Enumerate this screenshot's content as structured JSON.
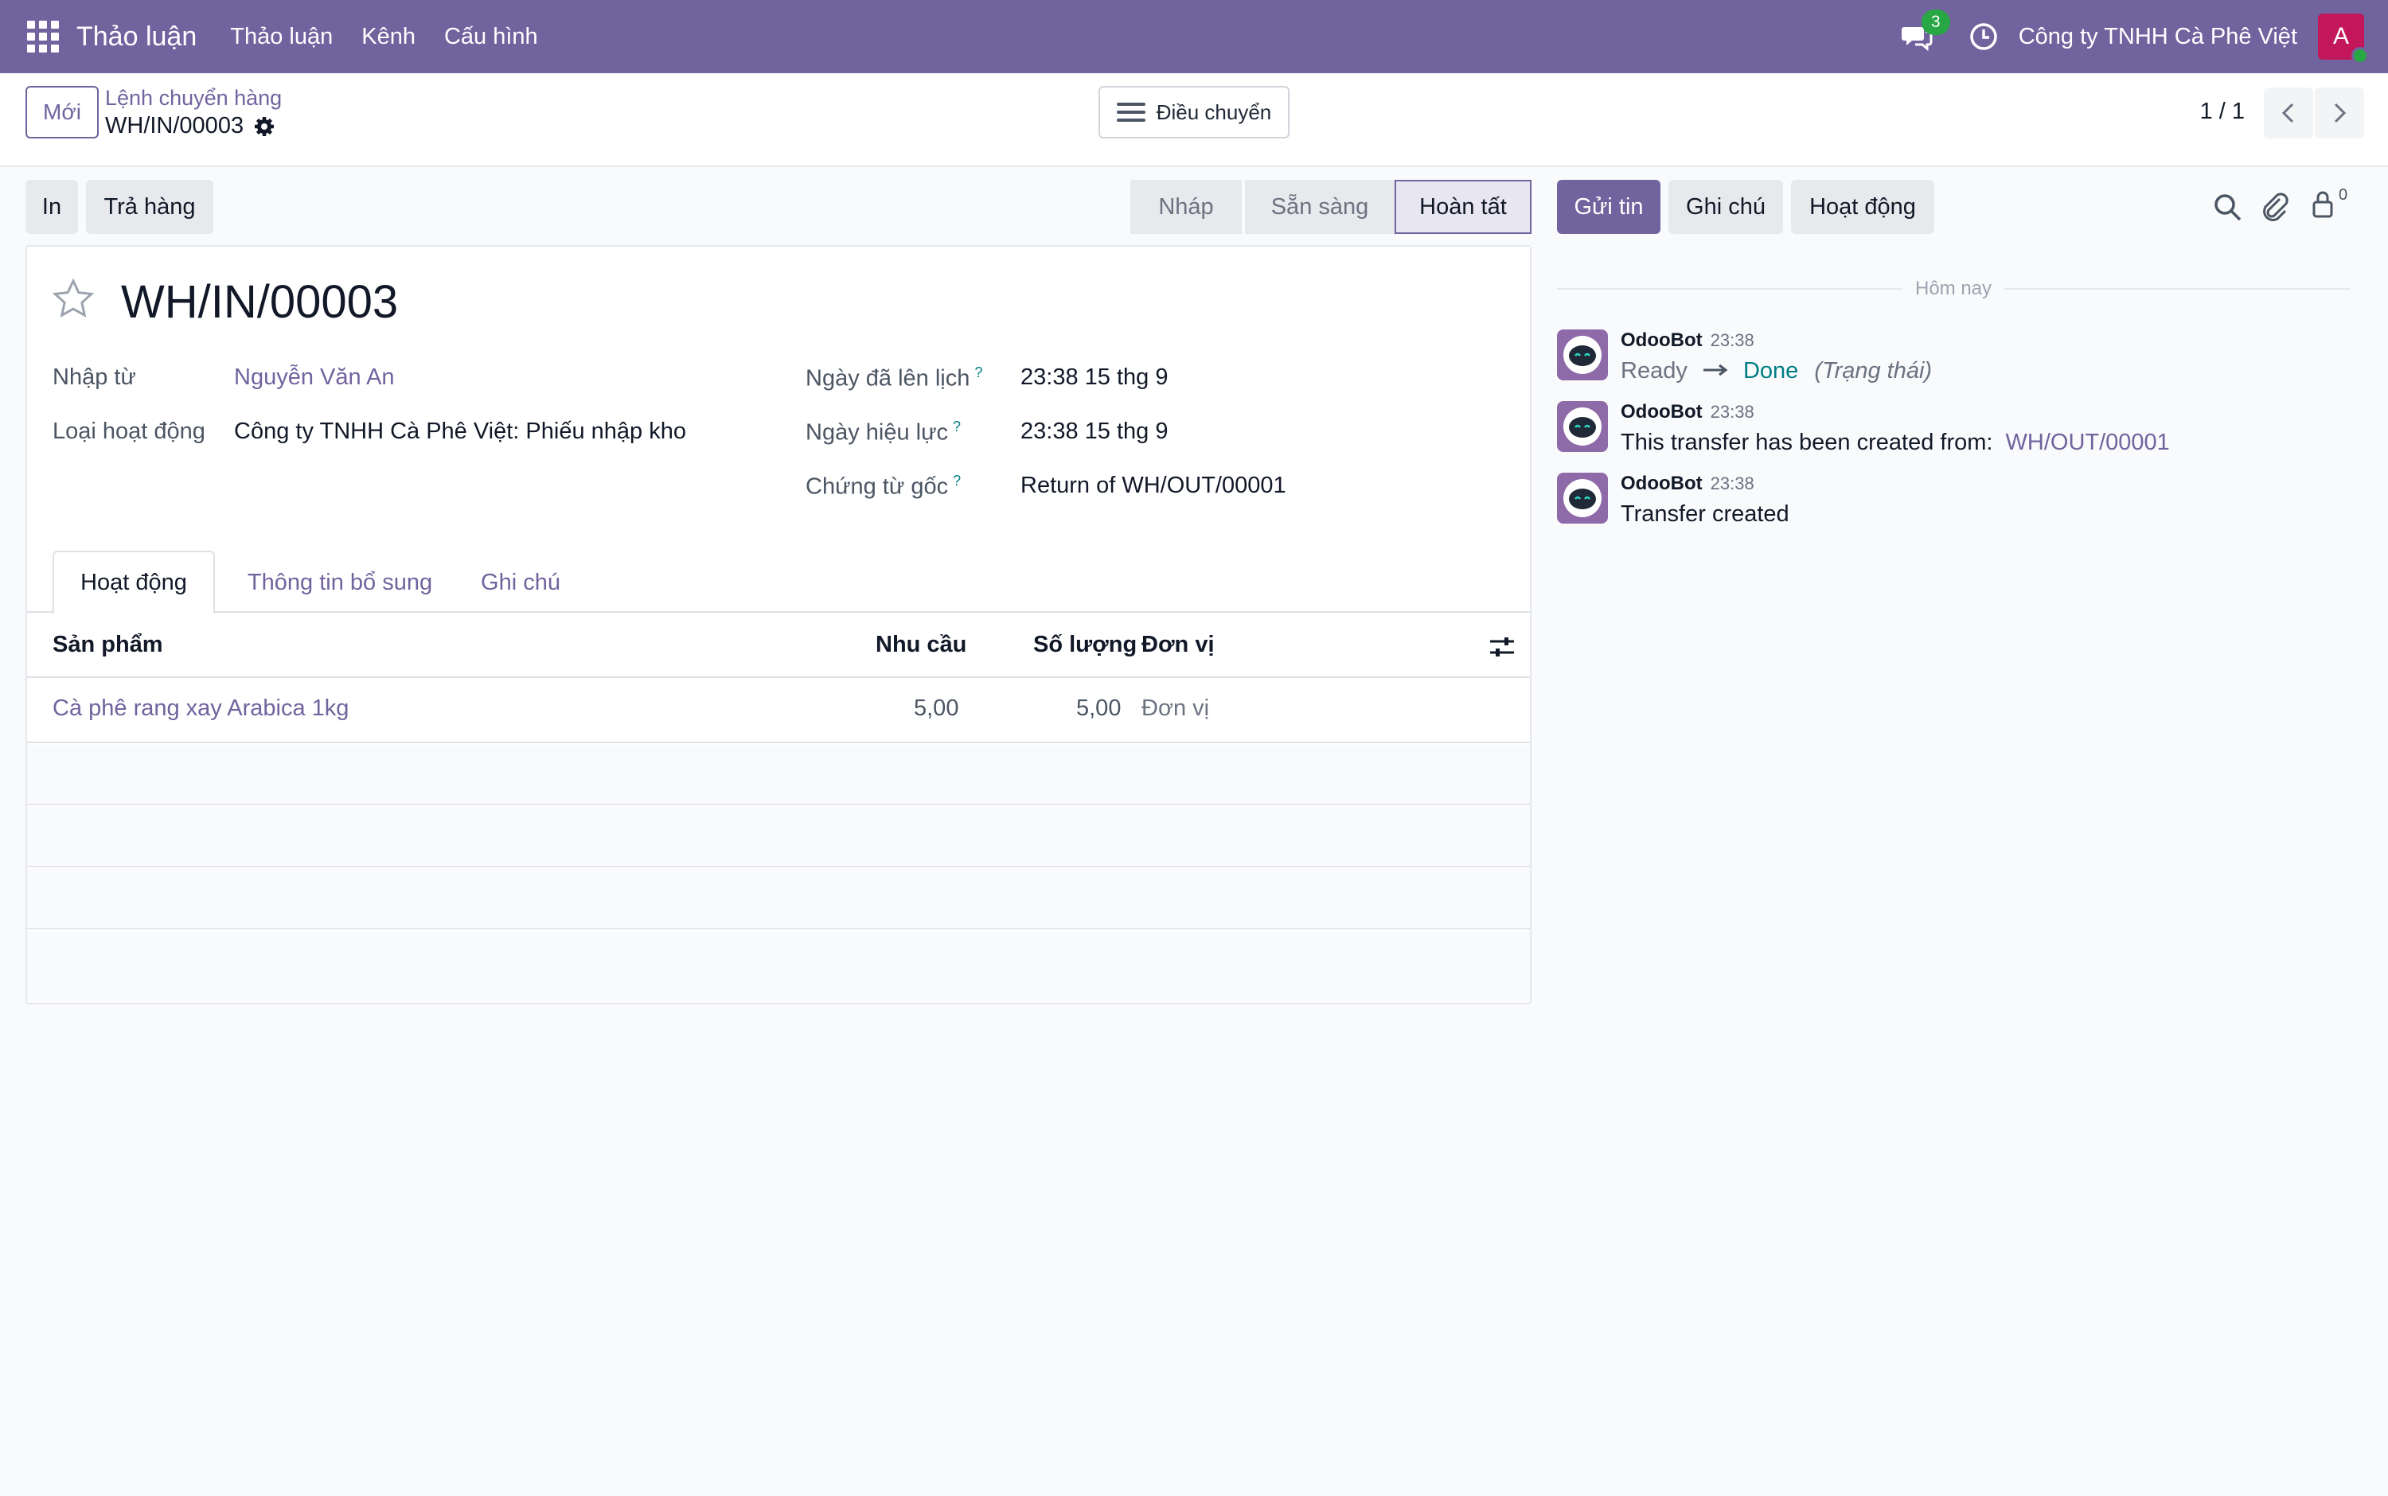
{
  "navbar": {
    "app_title": "Thảo luận",
    "menu": [
      "Thảo luận",
      "Kênh",
      "Cấu hình"
    ],
    "message_count": "3",
    "company": "Công ty TNHH Cà Phê Việt",
    "avatar_letter": "A"
  },
  "control": {
    "new_label": "Mới",
    "breadcrumb": "Lệnh chuyển hàng",
    "record_name": "WH/IN/00003",
    "transfer_label": "Điều chuyển",
    "pager": "1 / 1"
  },
  "actions": {
    "print_label": "In",
    "return_label": "Trả hàng"
  },
  "statusbar": {
    "stages": [
      "Nháp",
      "Sẵn sàng",
      "Hoàn tất"
    ],
    "active": "Hoàn tất"
  },
  "form": {
    "title": "WH/IN/00003",
    "fields_left": [
      {
        "label": "Nhập từ",
        "value": "Nguyễn Văn An"
      },
      {
        "label": "Loại hoạt động",
        "value": "Công ty TNHH Cà Phê Việt: Phiếu nhập kho"
      }
    ],
    "fields_right": [
      {
        "label": "Ngày đã lên lịch",
        "help": "?",
        "value": "23:38 15 thg 9"
      },
      {
        "label": "Ngày hiệu lực",
        "help": "?",
        "value": "23:38 15 thg 9"
      },
      {
        "label": "Chứng từ gốc",
        "help": "?",
        "value": "Return of WH/OUT/00001"
      }
    ],
    "tabs": [
      "Hoạt động",
      "Thông tin bổ sung",
      "Ghi chú"
    ],
    "table": {
      "headers": [
        "Sản phẩm",
        "Nhu cầu",
        "Số lượng",
        "Đơn vị"
      ],
      "rows": [
        {
          "product": "Cà phê rang xay Arabica 1kg",
          "demand": "5,00",
          "quantity": "5,00",
          "uom": "Đơn vị"
        }
      ]
    }
  },
  "chatter": {
    "send_label": "Gửi tin",
    "note_label": "Ghi chú",
    "activity_label": "Hoạt động",
    "followers_count": "0",
    "day_label": "Hôm nay",
    "messages": [
      {
        "author": "OdooBot",
        "time": "23:38",
        "old": "Ready",
        "new": "Done",
        "field": "(Trạng thái)"
      },
      {
        "author": "OdooBot",
        "time": "23:38",
        "text": "This transfer has been created from:",
        "link": "WH/OUT/00001"
      },
      {
        "author": "OdooBot",
        "time": "23:38",
        "text": "Transfer created"
      }
    ]
  },
  "colors": {
    "brand": "#71639e",
    "link_teal": "#017e84",
    "success": "#28a745"
  }
}
